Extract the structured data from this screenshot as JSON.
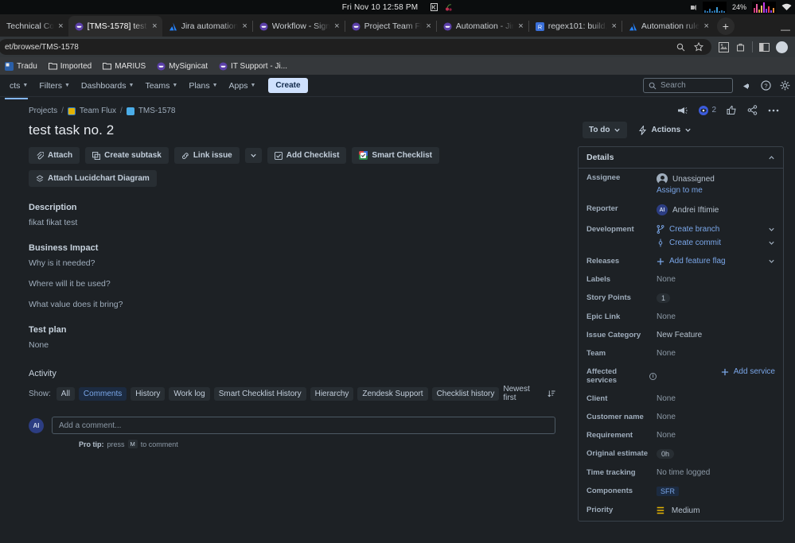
{
  "os_bar": {
    "clock": "Fri Nov 10  12:58 PM",
    "battery": "24%"
  },
  "browser": {
    "tabs": [
      {
        "title": "Technical Co",
        "favicon": "none",
        "active": false
      },
      {
        "title": "[TMS-1578] test t",
        "favicon": "jira",
        "active": true
      },
      {
        "title": "Jira automation",
        "favicon": "atlassian",
        "active": false
      },
      {
        "title": "Workflow - Sign",
        "favicon": "jira",
        "active": false
      },
      {
        "title": "Project Team Fl",
        "favicon": "jira",
        "active": false
      },
      {
        "title": "Automation - Jir",
        "favicon": "jira",
        "active": false
      },
      {
        "title": "regex101: build,",
        "favicon": "regex",
        "active": false
      },
      {
        "title": "Automation rule",
        "favicon": "atlassian",
        "active": false
      }
    ],
    "new_tab_label": "+",
    "minimize_label": "—",
    "url": "et/browse/TMS-1578",
    "bookmarks": [
      {
        "label": "Tradu",
        "icon": "app-icon"
      },
      {
        "label": "Imported",
        "icon": "folder-icon"
      },
      {
        "label": "MARIUS",
        "icon": "folder-icon"
      },
      {
        "label": "MySignicat",
        "icon": "jira-icon"
      },
      {
        "label": "IT Support - Ji...",
        "icon": "jira-icon"
      }
    ]
  },
  "jira_nav": {
    "items": [
      {
        "label": "cts",
        "caret": true
      },
      {
        "label": "Filters",
        "caret": true
      },
      {
        "label": "Dashboards",
        "caret": true
      },
      {
        "label": "Teams",
        "caret": true
      },
      {
        "label": "Plans",
        "caret": true
      },
      {
        "label": "Apps",
        "caret": true
      }
    ],
    "create_label": "Create",
    "search_placeholder": "Search"
  },
  "breadcrumb": {
    "projects": "Projects",
    "project": "Team Flux",
    "issue_key": "TMS-1578"
  },
  "issue": {
    "title": "test task no. 2",
    "actions": [
      {
        "label": "Attach",
        "icon": "paperclip-icon"
      },
      {
        "label": "Create subtask",
        "icon": "subtask-icon"
      },
      {
        "label": "Link issue",
        "icon": "link-icon"
      },
      {
        "label": "Add Checklist",
        "icon": "checkbox-icon"
      },
      {
        "label": "Smart Checklist",
        "icon": "smart-checklist-icon"
      },
      {
        "label": "Attach Lucidchart Diagram",
        "icon": "lucidchart-icon"
      }
    ],
    "sections": [
      {
        "heading": "Description",
        "lines": [
          "fikat fikat test"
        ]
      },
      {
        "heading": "Business Impact",
        "lines": [
          "Why is it needed?",
          "Where will it be used?",
          "What value does it bring?"
        ]
      },
      {
        "heading": "Test plan",
        "lines": [
          "None"
        ]
      }
    ]
  },
  "activity": {
    "heading": "Activity",
    "show_label": "Show:",
    "filters": [
      {
        "label": "All",
        "selected": false
      },
      {
        "label": "Comments",
        "selected": true
      },
      {
        "label": "History",
        "selected": false
      },
      {
        "label": "Work log",
        "selected": false
      },
      {
        "label": "Smart Checklist History",
        "selected": false
      },
      {
        "label": "Hierarchy",
        "selected": false
      },
      {
        "label": "Zendesk Support",
        "selected": false
      },
      {
        "label": "Checklist history",
        "selected": false
      }
    ],
    "sort_label": "Newest first",
    "avatar_initials": "AI",
    "comment_placeholder": "Add a comment...",
    "protip_prefix": "Pro tip:",
    "protip_mid": "press",
    "protip_key": "M",
    "protip_suffix": "to comment"
  },
  "right_panel": {
    "watch_count": "2",
    "status_label": "To do",
    "actions_label": "Actions",
    "details_title": "Details",
    "assignee": {
      "name": "Assignee",
      "value": "Unassigned",
      "assign_link": "Assign to me"
    },
    "fields": [
      {
        "name": "Reporter",
        "value": "Andrei Iftimie",
        "type": "avatar",
        "initials": "AI"
      },
      {
        "name": "Development",
        "value": "Create branch",
        "value2": "Create commit",
        "type": "dev"
      },
      {
        "name": "Releases",
        "value": "Add feature flag",
        "type": "addlink"
      },
      {
        "name": "Labels",
        "value": "None",
        "type": "muted"
      },
      {
        "name": "Story Points",
        "value": "1",
        "type": "pill"
      },
      {
        "name": "Epic Link",
        "value": "None",
        "type": "muted"
      },
      {
        "name": "Issue Category",
        "value": "New Feature",
        "type": "text"
      },
      {
        "name": "Team",
        "value": "None",
        "type": "muted"
      },
      {
        "name": "Affected services",
        "value": "Add service",
        "type": "addservice",
        "info": true
      },
      {
        "name": "Client",
        "value": "None",
        "type": "muted"
      },
      {
        "name": "Customer name",
        "value": "None",
        "type": "muted"
      },
      {
        "name": "Requirement",
        "value": "None",
        "type": "muted"
      },
      {
        "name": "Original estimate",
        "value": "0h",
        "type": "pill"
      },
      {
        "name": "Time tracking",
        "value": "No time logged",
        "type": "muted"
      },
      {
        "name": "Components",
        "value": "SFR",
        "type": "tag"
      },
      {
        "name": "Priority",
        "value": "Medium",
        "type": "priority"
      }
    ]
  },
  "colors": {
    "accent_blue": "#7aa6e8",
    "jira_purple": "#5b3fa8",
    "priority_yellow": "#e2b203",
    "page_bg": "#1d2125"
  }
}
